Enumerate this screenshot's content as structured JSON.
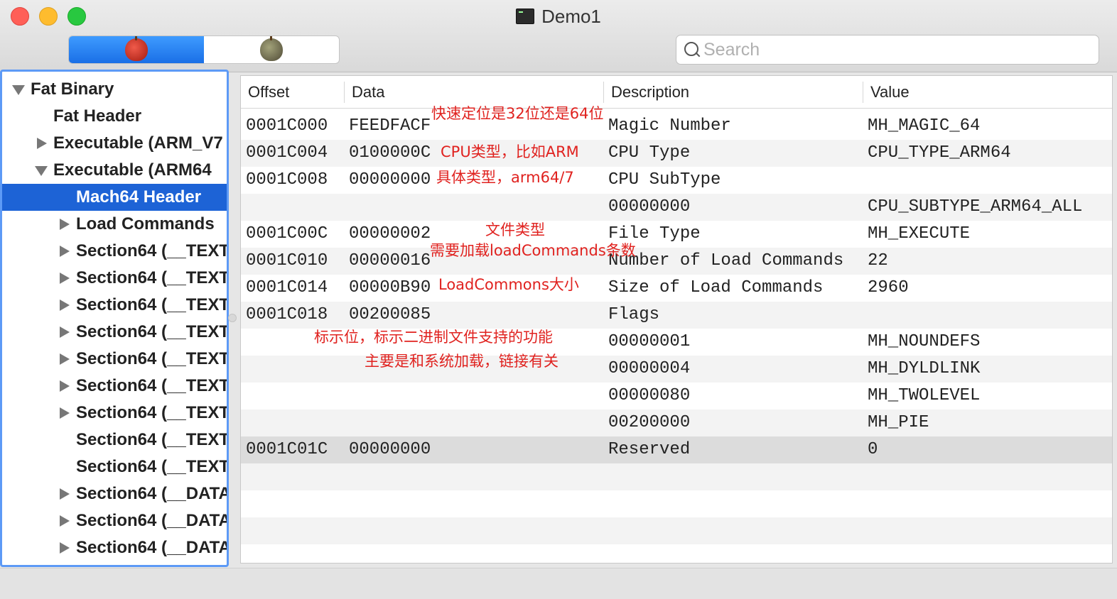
{
  "window": {
    "title": "Demo1"
  },
  "toolbar": {
    "segments": [
      {
        "icon": "red-apple-icon",
        "active": true
      },
      {
        "icon": "gray-apple-icon",
        "active": false
      }
    ],
    "search_placeholder": "Search"
  },
  "sidebar": {
    "items": [
      {
        "label": "Fat Binary",
        "disclosure": "down",
        "level": 0
      },
      {
        "label": "Fat Header",
        "disclosure": "none",
        "level": 1
      },
      {
        "label": "Executable (ARM_V7",
        "disclosure": "right",
        "level": 1
      },
      {
        "label": "Executable (ARM64",
        "disclosure": "down",
        "level": 1
      },
      {
        "label": "Mach64 Header",
        "disclosure": "none",
        "level": 2,
        "selected": true
      },
      {
        "label": "Load Commands",
        "disclosure": "right",
        "level": 2
      },
      {
        "label": "Section64 (__TEXT",
        "disclosure": "right",
        "level": 2
      },
      {
        "label": "Section64 (__TEXT",
        "disclosure": "right",
        "level": 2
      },
      {
        "label": "Section64 (__TEXT",
        "disclosure": "right",
        "level": 2
      },
      {
        "label": "Section64 (__TEXT",
        "disclosure": "right",
        "level": 2
      },
      {
        "label": "Section64 (__TEXT",
        "disclosure": "right",
        "level": 2
      },
      {
        "label": "Section64 (__TEXT",
        "disclosure": "right",
        "level": 2
      },
      {
        "label": "Section64 (__TEXT",
        "disclosure": "right",
        "level": 2
      },
      {
        "label": "Section64 (__TEXT",
        "disclosure": "none",
        "level": 2
      },
      {
        "label": "Section64 (__TEXT",
        "disclosure": "none",
        "level": 2
      },
      {
        "label": "Section64 (__DATA",
        "disclosure": "right",
        "level": 2
      },
      {
        "label": "Section64 (__DATA",
        "disclosure": "right",
        "level": 2
      },
      {
        "label": "Section64 (__DATA",
        "disclosure": "right",
        "level": 2
      }
    ]
  },
  "table": {
    "columns": [
      "Offset",
      "Data",
      "Description",
      "Value"
    ],
    "rows": [
      {
        "offset": "0001C000",
        "data": "FEEDFACF",
        "description": "Magic Number",
        "value": "MH_MAGIC_64"
      },
      {
        "offset": "0001C004",
        "data": "0100000C",
        "description": "CPU Type",
        "value": "CPU_TYPE_ARM64"
      },
      {
        "offset": "0001C008",
        "data": "00000000",
        "description": "CPU SubType",
        "value": ""
      },
      {
        "offset": "",
        "data": "",
        "description": "00000000",
        "value": "CPU_SUBTYPE_ARM64_ALL"
      },
      {
        "offset": "0001C00C",
        "data": "00000002",
        "description": "File Type",
        "value": "MH_EXECUTE"
      },
      {
        "offset": "0001C010",
        "data": "00000016",
        "description": "Number of Load Commands",
        "value": "22"
      },
      {
        "offset": "0001C014",
        "data": "00000B90",
        "description": "Size of Load Commands",
        "value": "2960"
      },
      {
        "offset": "0001C018",
        "data": "00200085",
        "description": "Flags",
        "value": ""
      },
      {
        "offset": "",
        "data": "",
        "description": "00000001",
        "value": "MH_NOUNDEFS"
      },
      {
        "offset": "",
        "data": "",
        "description": "00000004",
        "value": "MH_DYLDLINK"
      },
      {
        "offset": "",
        "data": "",
        "description": "00000080",
        "value": "MH_TWOLEVEL"
      },
      {
        "offset": "",
        "data": "",
        "description": "00200000",
        "value": "MH_PIE"
      },
      {
        "offset": "0001C01C",
        "data": "00000000",
        "description": "Reserved",
        "value": "0",
        "selected": true
      },
      {
        "offset": "",
        "data": "",
        "description": "",
        "value": ""
      },
      {
        "offset": "",
        "data": "",
        "description": "",
        "value": ""
      },
      {
        "offset": "",
        "data": "",
        "description": "",
        "value": ""
      }
    ]
  },
  "annotations": [
    "快速定位是32位还是64位",
    "CPU类型，比如ARM",
    "具体类型，arm64/7",
    "文件类型",
    "需要加载loadCommands条数",
    "LoadCommons大小",
    "标示位，标示二进制文件支持的功能",
    "主要是和系统加载，链接有关"
  ]
}
